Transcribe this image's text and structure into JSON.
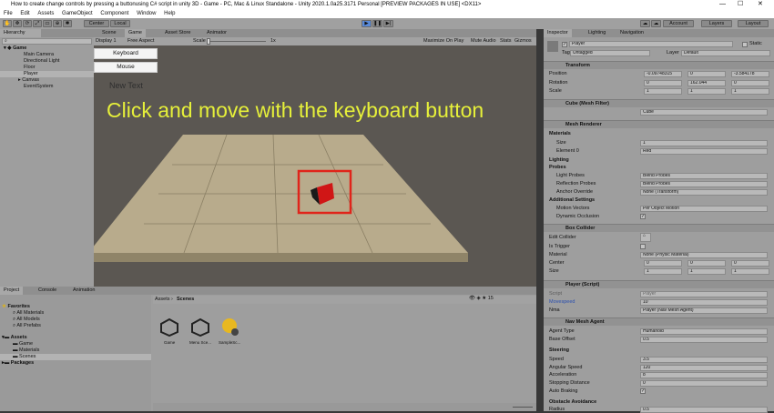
{
  "window": {
    "title": "How to create change controls by pressing a buttonusing C# script in unity 3D - Game - PC, Mac & Linux Standalone - Unity 2020.1.0a25.3171 Personal [PREVIEW PACKAGES IN USE] <DX11>",
    "min": "—",
    "max": "☐",
    "close": "✕"
  },
  "menu": [
    "File",
    "Edit",
    "Assets",
    "GameObject",
    "Component",
    "Window",
    "Help"
  ],
  "toolbar": {
    "center": "Center",
    "local": "Local",
    "account": "Account",
    "layers": "Layers",
    "layout": "Layout"
  },
  "hierarchy": {
    "tab": "Hierarchy",
    "scene": "Game",
    "items": [
      "Main Camera",
      "Directional Light",
      "Floor",
      "Player",
      "Canvas",
      "EventSystem"
    ]
  },
  "view": {
    "tabs": [
      "Scene",
      "Game",
      "Asset Store",
      "Animator"
    ],
    "display": "Display 1",
    "aspect": "Free Aspect",
    "scale_label": "Scale",
    "scale_value": "1x",
    "maximize": "Maximize On Play",
    "mute": "Mute Audio",
    "stats": "Stats",
    "gizmos": "Gizmos"
  },
  "game": {
    "btn_keyboard": "Keyboard",
    "btn_mouse": "Mouse",
    "new_text": "New Text",
    "headline": "Click and move with the keyboard button"
  },
  "project": {
    "tabs": [
      "Project",
      "Console",
      "Animation"
    ],
    "favorites": "Favorites",
    "fav_items": [
      "All Materials",
      "All Models",
      "All Prefabs"
    ],
    "assets": "Assets",
    "asset_items": [
      "Game",
      "Materials",
      "Scenes"
    ],
    "packages": "Packages",
    "breadcrumb_root": "Assets",
    "breadcrumb_leaf": "Scenes",
    "files": [
      "Game",
      "Menu Sce...",
      "SampleSc..."
    ]
  },
  "inspector": {
    "tabs": [
      "Inspector",
      "Lighting",
      "Navigation"
    ],
    "name": "Player",
    "static": "Static",
    "tag_label": "Tag",
    "tag": "Untagged",
    "layer_label": "Layer",
    "layer": "Default",
    "transform": {
      "title": "Transform",
      "position": "Position",
      "rotation": "Rotation",
      "scale": "Scale",
      "pos": [
        "-0.09748315",
        "0",
        "-3.584178"
      ],
      "rot": [
        "0",
        "162.044",
        "0"
      ],
      "scl": [
        "1",
        "1",
        "1"
      ]
    },
    "meshfilter": {
      "title": "Cube (Mesh Filter)",
      "mesh": "Cube"
    },
    "renderer": {
      "title": "Mesh Renderer",
      "materials": "Materials",
      "size_label": "Size",
      "size": "1",
      "element_label": "Element 0",
      "element": "Red",
      "lighting": "Lighting",
      "probes": "Probes",
      "light_probes_label": "Light Probes",
      "light_probes": "Blend Probes",
      "reflection_label": "Reflection Probes",
      "reflection": "Blend Probes",
      "anchor_label": "Anchor Override",
      "anchor": "None (Transform)",
      "additional": "Additional Settings",
      "motion_label": "Motion Vectors",
      "motion": "Per Object Motion",
      "dynamic_label": "Dynamic Occlusion"
    },
    "collider": {
      "title": "Box Collider",
      "edit_label": "Edit Collider",
      "trigger_label": "Is Trigger",
      "material_label": "Material",
      "material": "None (Physic Material)",
      "center_label": "Center",
      "center": [
        "0",
        "0",
        "0"
      ],
      "size_label": "Size",
      "size": [
        "1",
        "1",
        "1"
      ]
    },
    "script": {
      "title": "Player (Script)",
      "script_label": "Script",
      "script": "Player",
      "speed_label": "Movespeed",
      "speed": "10",
      "nma_label": "Nma",
      "nma": "Player (Nav Mesh Agent)"
    },
    "agent": {
      "title": "Nav Mesh Agent",
      "type_label": "Agent Type",
      "type": "Humanoid",
      "offset_label": "Base Offset",
      "offset": "0.5",
      "steering": "Steering",
      "speed_label": "Speed",
      "speed": "3.5",
      "ang_label": "Angular Speed",
      "ang": "120",
      "acc_label": "Acceleration",
      "acc": "8",
      "stop_label": "Stopping Distance",
      "stop": "0",
      "brake_label": "Auto Braking",
      "avoid": "Obstacle Avoidance",
      "radius_label": "Radius",
      "radius": "0.5"
    }
  },
  "slider_count": "15",
  "colors": {
    "accent": "#5a8ad8",
    "headline": "#e6f03a",
    "highlight": "#e0241a"
  }
}
